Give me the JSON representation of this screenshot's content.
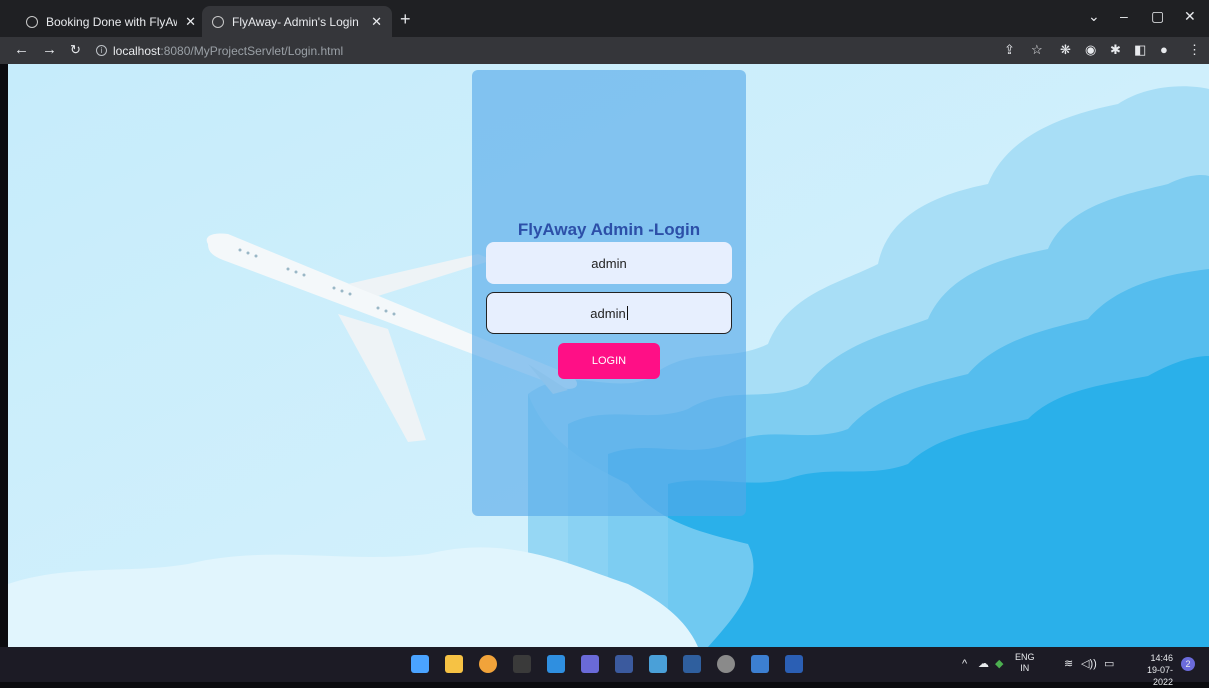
{
  "browser": {
    "tabs": [
      {
        "title": "Booking Done with FlyAway !!",
        "active": false
      },
      {
        "title": "FlyAway- Admin's Login",
        "active": true
      }
    ],
    "url_host": "localhost",
    "url_rest": ":8080/MyProjectServlet/Login.html"
  },
  "form": {
    "title": "FlyAway Admin -Login",
    "username_value": "admin",
    "password_value": "admin",
    "login_label": "LOGIN"
  },
  "taskbar": {
    "lang_top": "ENG",
    "lang_bottom": "IN",
    "time": "14:46",
    "date": "19-07-2022",
    "notification_count": "2"
  },
  "colors": {
    "card": "#54a8e8",
    "title": "#2c4fa8",
    "login_button": "#ff0f86",
    "input_bg": "#e7effe"
  }
}
